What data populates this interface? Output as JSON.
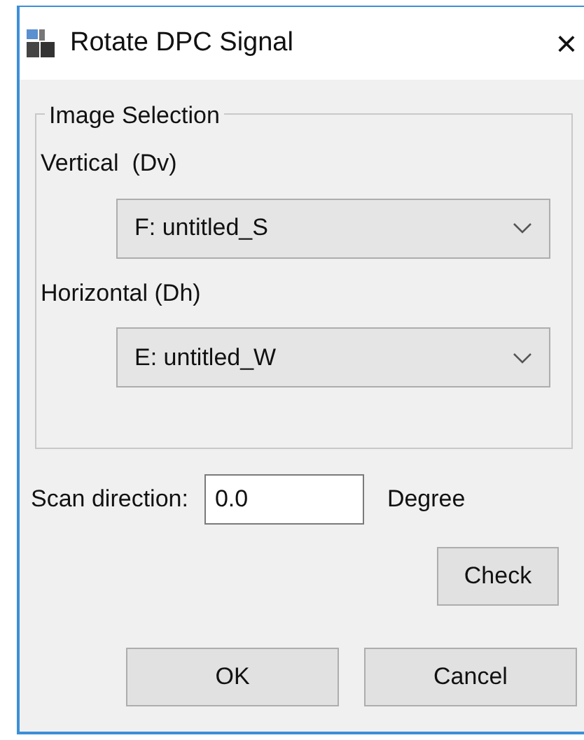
{
  "window": {
    "title": "Rotate DPC Signal",
    "close": "×"
  },
  "group": {
    "legend": "Image Selection",
    "selectors": [
      {
        "label": "Vertical  (Dv)",
        "value": "F: untitled_S"
      },
      {
        "label": "Horizontal (Dh)",
        "value": "E: untitled_W"
      }
    ]
  },
  "scan": {
    "label": "Scan direction:",
    "value": "0.0",
    "unit": "Degree"
  },
  "check_button": "Check",
  "buttons": [
    "OK",
    "Cancel"
  ]
}
